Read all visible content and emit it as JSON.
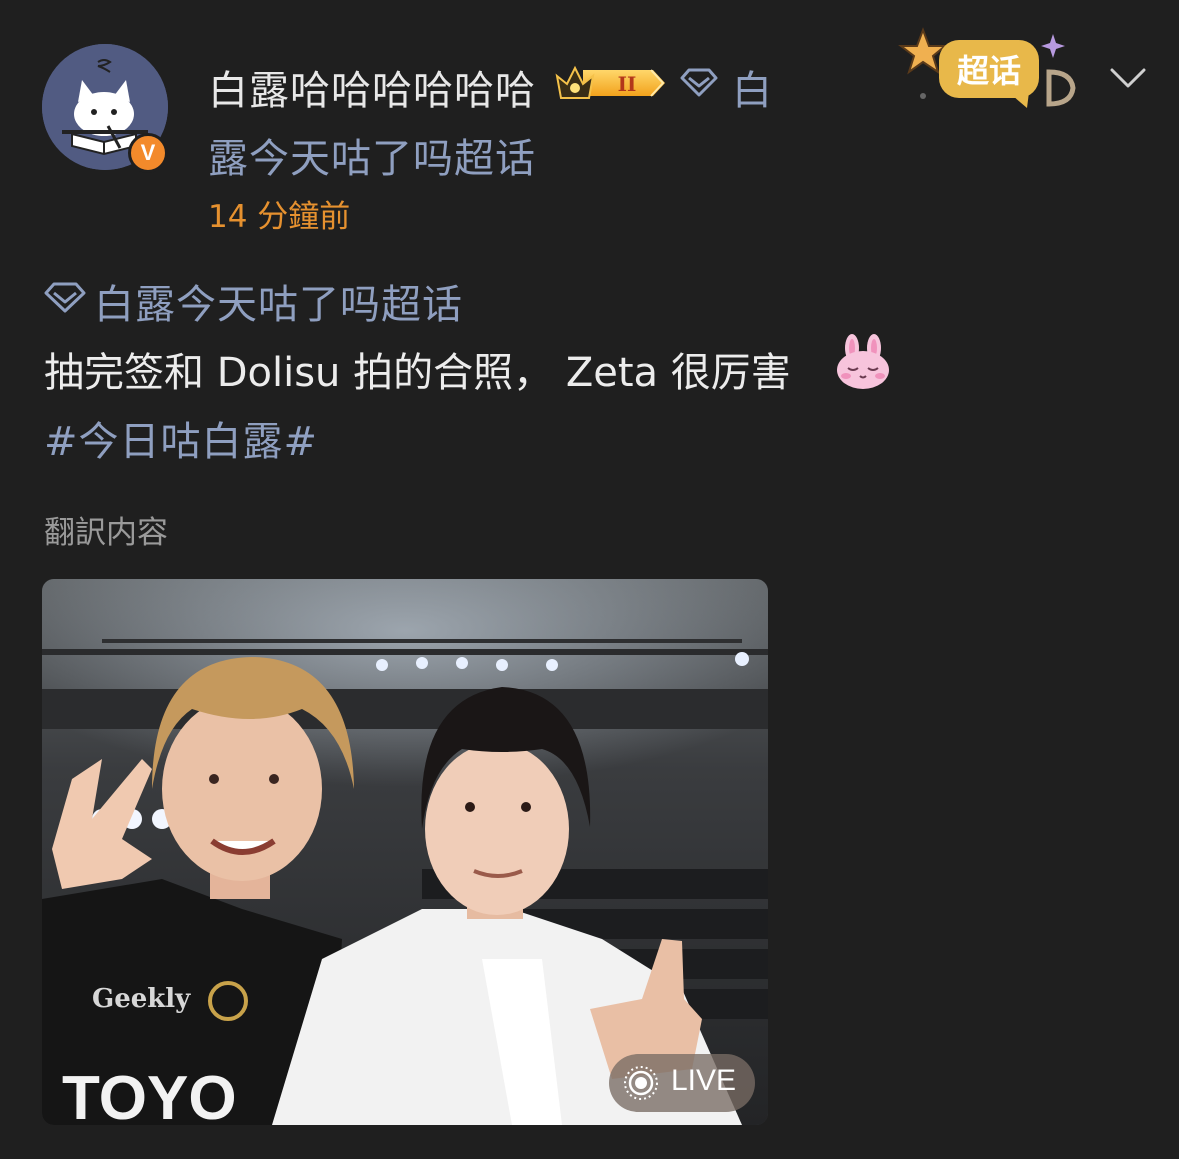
{
  "post": {
    "author": {
      "name": "白露哈哈哈哈哈哈",
      "crown_level": "II",
      "verified_mark": "V"
    },
    "supertopic": {
      "line1": "白",
      "line2": "露今天咕了吗超话",
      "icon": "diamond-icon"
    },
    "timestamp": "14 分鐘前",
    "sticker_label": "超话",
    "topic_label": "白露今天咕了吗超话",
    "text": "抽完签和 Dolisu 拍的合照， Zeta 很厉害",
    "hashtag": "#今日咕白露#",
    "translate_label": "翻訳内容",
    "photo": {
      "live_label": "LIVE",
      "jersey_sponsor_1": "Geekly",
      "jersey_sponsor_2": "TOYO"
    }
  },
  "colors": {
    "background": "#1f1f1f",
    "link": "#8f9fc0",
    "timestamp": "#e6912f",
    "verified": "#f38a2b",
    "sticker_gold": "#e8b84a"
  }
}
